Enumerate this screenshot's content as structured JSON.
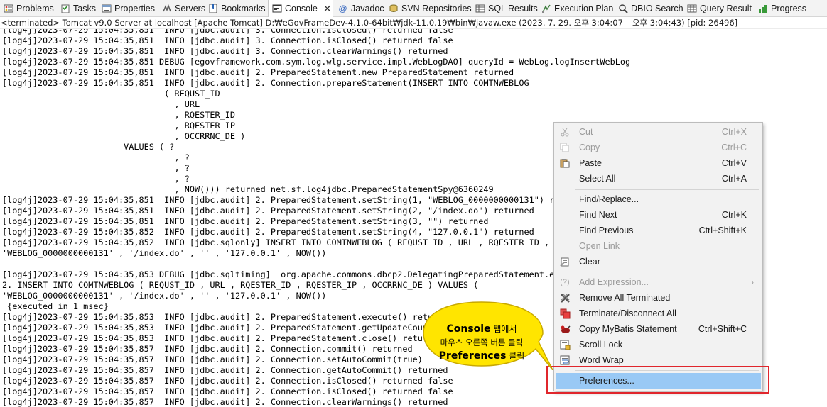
{
  "tabs": [
    {
      "label": "Problems",
      "icon": "problems-icon"
    },
    {
      "label": "Tasks",
      "icon": "tasks-icon"
    },
    {
      "label": "Properties",
      "icon": "properties-icon"
    },
    {
      "label": "Servers",
      "icon": "servers-icon"
    },
    {
      "label": "Bookmarks",
      "icon": "bookmarks-icon"
    },
    {
      "label": "Console",
      "icon": "console-icon",
      "active": true
    },
    {
      "label": "Javadoc",
      "icon": "javadoc-icon"
    },
    {
      "label": "SVN Repositories",
      "icon": "svn-icon"
    },
    {
      "label": "SQL Results",
      "icon": "sql-results-icon"
    },
    {
      "label": "Execution Plan",
      "icon": "execution-plan-icon"
    },
    {
      "label": "DBIO Search",
      "icon": "dbio-search-icon"
    },
    {
      "label": "Query Result",
      "icon": "query-result-icon"
    },
    {
      "label": "Progress",
      "icon": "progress-icon"
    }
  ],
  "tab_close": "✕",
  "status": "<terminated> Tomcat v9.0 Server at localhost [Apache Tomcat] D:₩eGovFrameDev-4.1.0-64bit₩jdk-11.0.19₩bin₩javaw.exe  (2023. 7. 29. 오후 3:04:07 – 오후 3:04:43) [pid: 26496]",
  "console_lines": [
    "[log4j]2023-07-29 15:04:35,851  INFO [jdbc.audit] 3. Connection.isClosed() returned false",
    "[log4j]2023-07-29 15:04:35,851  INFO [jdbc.audit] 3. Connection.isClosed() returned false",
    "[log4j]2023-07-29 15:04:35,851  INFO [jdbc.audit] 3. Connection.clearWarnings() returned",
    "[log4j]2023-07-29 15:04:35,851 DEBUG [egovframework.com.sym.log.wlg.service.impl.WebLogDAO] queryId = WebLog.logInsertWebLog",
    "[log4j]2023-07-29 15:04:35,851  INFO [jdbc.audit] 2. PreparedStatement.new PreparedStatement returned",
    "[log4j]2023-07-29 15:04:35,851  INFO [jdbc.audit] 2. Connection.prepareStatement(INSERT INTO COMTNWEBLOG",
    "                                ( REQUST_ID",
    "                                  , URL",
    "                                  , RQESTER_ID",
    "                                  , RQESTER_IP",
    "                                  , OCCRRNC_DE )",
    "                        VALUES ( ?",
    "                                  , ?",
    "                                  , ?",
    "                                  , ?",
    "                                  , NOW())) returned net.sf.log4jdbc.PreparedStatementSpy@6360249",
    "[log4j]2023-07-29 15:04:35,851  INFO [jdbc.audit] 2. PreparedStatement.setString(1, \"WEBLOG_0000000000131\") ret",
    "[log4j]2023-07-29 15:04:35,851  INFO [jdbc.audit] 2. PreparedStatement.setString(2, \"/index.do\") returned",
    "[log4j]2023-07-29 15:04:35,851  INFO [jdbc.audit] 2. PreparedStatement.setString(3, \"\") returned",
    "[log4j]2023-07-29 15:04:35,852  INFO [jdbc.audit] 2. PreparedStatement.setString(4, \"127.0.0.1\") returned",
    "[log4j]2023-07-29 15:04:35,852  INFO [jdbc.sqlonly] INSERT INTO COMTNWEBLOG ( REQUST_ID , URL , RQESTER_ID , RQ",
    "'WEBLOG_0000000000131' , '/index.do' , '' , '127.0.0.1' , NOW())",
    "",
    "[log4j]2023-07-29 15:04:35,853 DEBUG [jdbc.sqltiming]  org.apache.commons.dbcp2.DelegatingPreparedStatement.exe",
    "2. INSERT INTO COMTNWEBLOG ( REQUST_ID , URL , RQESTER_ID , RQESTER_IP , OCCRRNC_DE ) VALUES (",
    "'WEBLOG_0000000000131' , '/index.do' , '' , '127.0.0.1' , NOW())",
    " {executed in 1 msec}",
    "[log4j]2023-07-29 15:04:35,853  INFO [jdbc.audit] 2. PreparedStatement.execute() returned f",
    "[log4j]2023-07-29 15:04:35,853  INFO [jdbc.audit] 2. PreparedStatement.getUpdateCount",
    "[log4j]2023-07-29 15:04:35,853  INFO [jdbc.audit] 2. PreparedStatement.close() retu",
    "[log4j]2023-07-29 15:04:35,857  INFO [jdbc.audit] 2. Connection.commit() returned",
    "[log4j]2023-07-29 15:04:35,857  INFO [jdbc.audit] 2. Connection.setAutoCommit(true)",
    "[log4j]2023-07-29 15:04:35,857  INFO [jdbc.audit] 2. Connection.getAutoCommit() returned",
    "[log4j]2023-07-29 15:04:35,857  INFO [jdbc.audit] 2. Connection.isClosed() returned false",
    "[log4j]2023-07-29 15:04:35,857  INFO [jdbc.audit] 2. Connection.isClosed() returned false",
    "[log4j]2023-07-29 15:04:35,857  INFO [jdbc.audit] 2. Connection.clearWarnings() returned"
  ],
  "context_menu": [
    {
      "label": "Cut",
      "shortcut": "Ctrl+X",
      "icon": "cut-icon",
      "disabled": true
    },
    {
      "label": "Copy",
      "shortcut": "Ctrl+C",
      "icon": "copy-icon",
      "disabled": true
    },
    {
      "label": "Paste",
      "shortcut": "Ctrl+V",
      "icon": "paste-icon"
    },
    {
      "label": "Select All",
      "shortcut": "Ctrl+A"
    },
    {
      "separator": true
    },
    {
      "label": "Find/Replace..."
    },
    {
      "label": "Find Next",
      "shortcut": "Ctrl+K"
    },
    {
      "label": "Find Previous",
      "shortcut": "Ctrl+Shift+K"
    },
    {
      "label": "Open Link",
      "disabled": true
    },
    {
      "label": "Clear",
      "icon": "clear-icon"
    },
    {
      "separator": true
    },
    {
      "label": "Add Expression...",
      "icon": "add-expression-icon",
      "disabled": true,
      "submenu": true
    },
    {
      "label": "Remove All Terminated",
      "icon": "remove-all-terminated-icon"
    },
    {
      "label": "Terminate/Disconnect All",
      "icon": "terminate-icon"
    },
    {
      "label": "Copy MyBatis Statement",
      "shortcut": "Ctrl+Shift+C",
      "icon": "mybatis-icon"
    },
    {
      "label": "Scroll Lock",
      "icon": "scroll-lock-icon"
    },
    {
      "label": "Word Wrap",
      "icon": "word-wrap-icon"
    },
    {
      "separator": true
    },
    {
      "label": "Preferences...",
      "selected": true
    }
  ],
  "submenu_arrow": "›",
  "callout": {
    "line1_bold": "Console",
    "line1_rest": " 탭에서",
    "line2": "마우스 오른쪽 버튼 클릭",
    "line3_bold": "Preferences",
    "line3_rest": " 클릭"
  },
  "colors": {
    "callout_fill": "#ffe500",
    "callout_stroke": "#c8a800",
    "highlight_box": "#e0262c",
    "menu_selected": "#99c9f5"
  }
}
